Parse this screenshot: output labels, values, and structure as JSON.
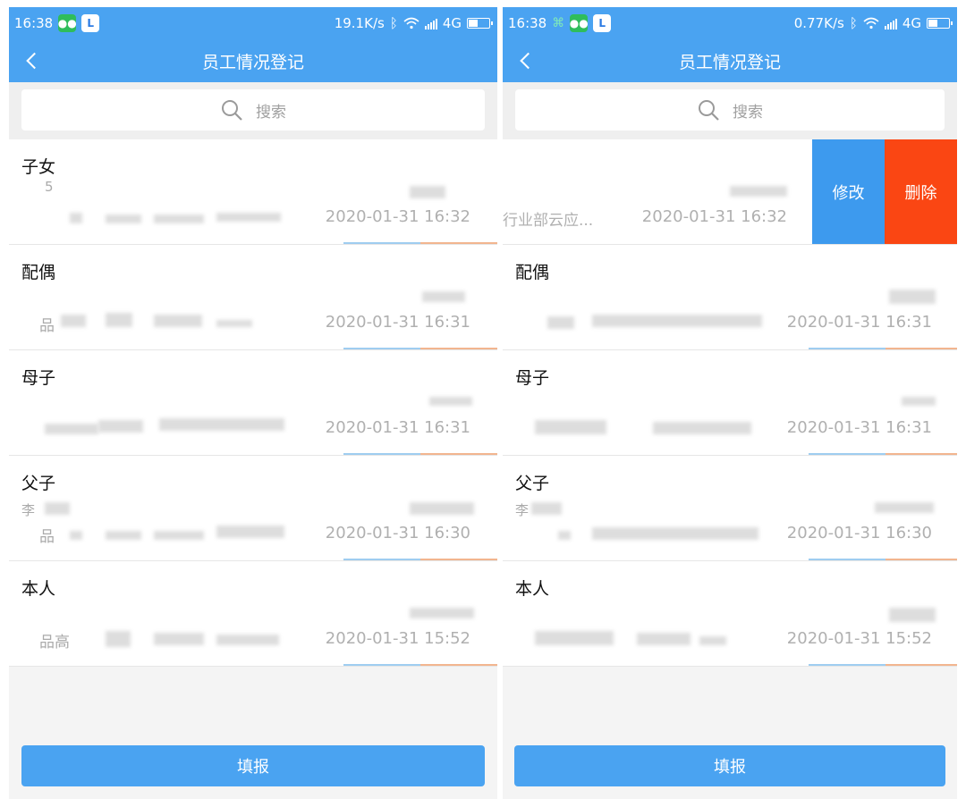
{
  "screens": [
    {
      "status_bar": {
        "time": "16:38",
        "speed": "19.1K/s",
        "network": "4G"
      },
      "header": {
        "title": "员工情况登记"
      },
      "search": {
        "placeholder": "搜索"
      },
      "rows": [
        {
          "label": "子女",
          "line1": "5",
          "line2": "",
          "timestamp": "2020-01-31 16:32"
        },
        {
          "label": "配偶",
          "line1": "",
          "line2": "品",
          "timestamp": "2020-01-31 16:31"
        },
        {
          "label": "母子",
          "line1": "",
          "line2": "",
          "timestamp": "2020-01-31 16:31"
        },
        {
          "label": "父子",
          "line1": "李",
          "line2": "品",
          "timestamp": "2020-01-31 16:30"
        },
        {
          "label": "本人",
          "line1": "",
          "line2": "品高",
          "timestamp": "2020-01-31 15:52"
        }
      ],
      "footer": {
        "submit_label": "填报"
      }
    },
    {
      "status_bar": {
        "time": "16:38",
        "speed": "0.77K/s",
        "network": "4G"
      },
      "header": {
        "title": "员工情况登记"
      },
      "search": {
        "placeholder": "搜索"
      },
      "rows": [
        {
          "label": "",
          "line1": "",
          "line2": "行业部云应...",
          "timestamp": "2020-01-31 16:32"
        },
        {
          "label": "配偶",
          "line1": "",
          "line2": "",
          "timestamp": "2020-01-31 16:31"
        },
        {
          "label": "母子",
          "line1": "",
          "line2": "",
          "timestamp": "2020-01-31 16:31"
        },
        {
          "label": "父子",
          "line1": "李",
          "line2": "",
          "timestamp": "2020-01-31 16:30"
        },
        {
          "label": "本人",
          "line1": "",
          "line2": "",
          "timestamp": "2020-01-31 15:52"
        }
      ],
      "swipe_actions": {
        "edit_label": "修改",
        "delete_label": "删除"
      },
      "footer": {
        "submit_label": "填报"
      }
    }
  ],
  "colors": {
    "header": "#4aa3f1",
    "edit": "#3d9aee",
    "delete": "#fa4613"
  },
  "icons": [
    "back-icon",
    "search-icon",
    "wechat-icon",
    "app-l-icon",
    "usb-icon",
    "bluetooth-icon",
    "wifi-icon",
    "signal-icon",
    "battery-icon"
  ]
}
